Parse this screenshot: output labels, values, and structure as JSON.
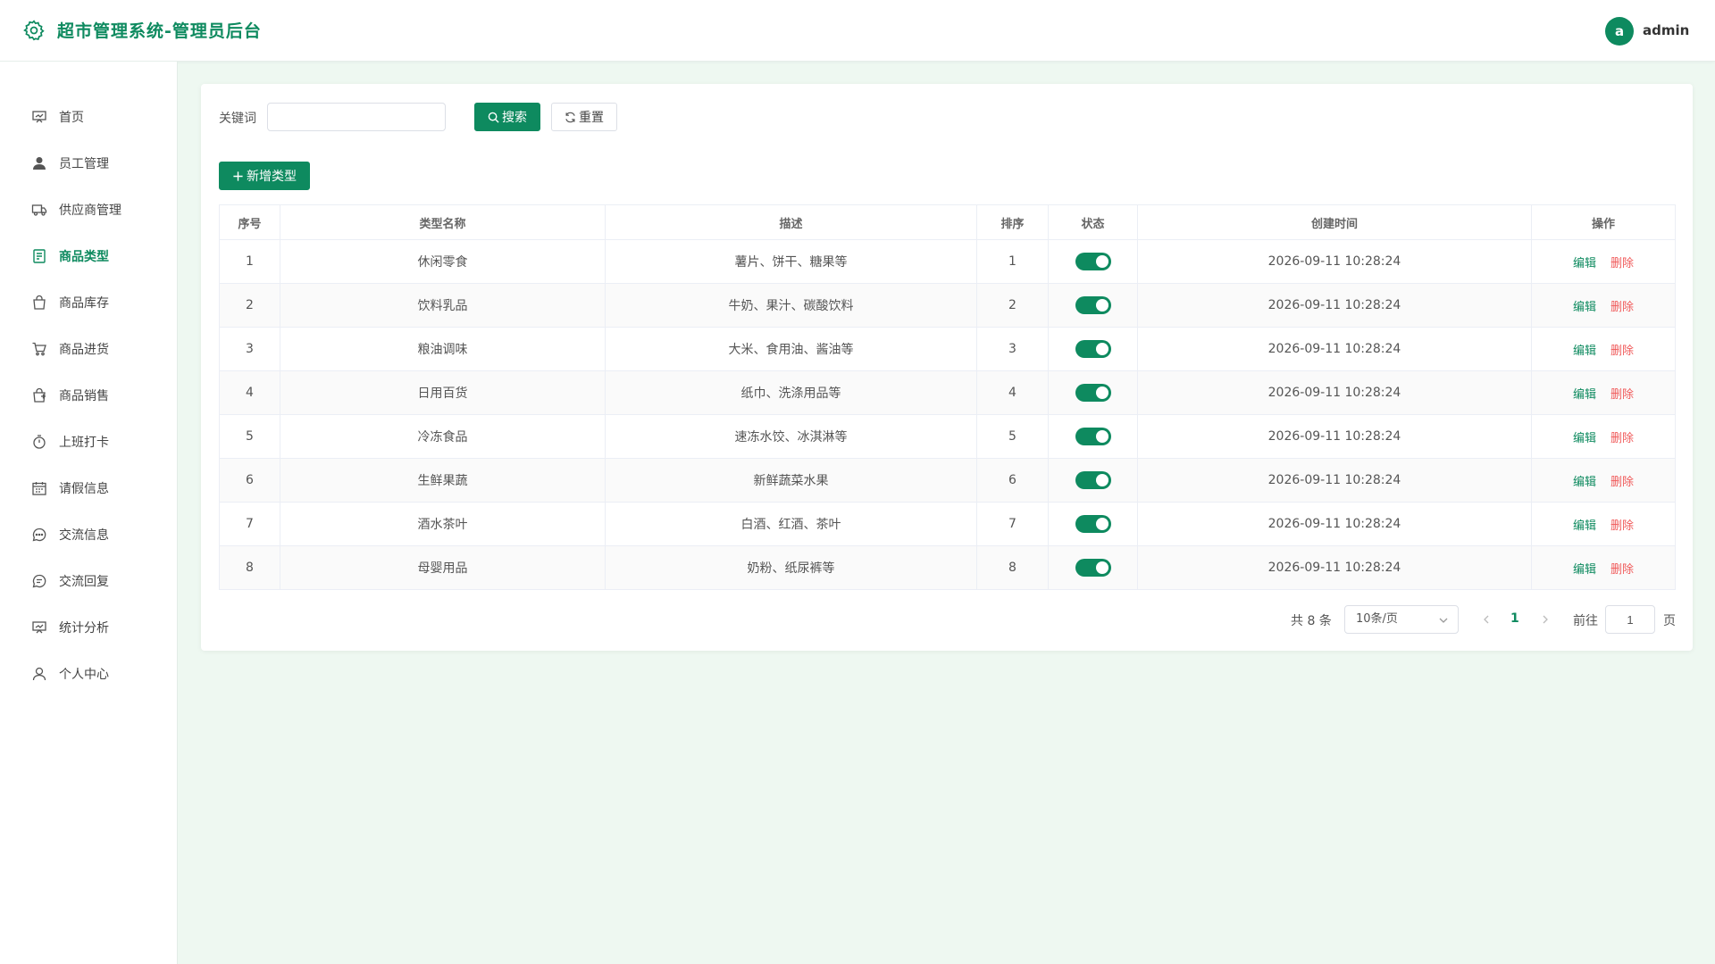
{
  "header": {
    "title": "超市管理系统-管理员后台",
    "avatar_letter": "a",
    "username": "admin"
  },
  "sidebar": {
    "items": [
      {
        "label": "首页",
        "icon": "dashboard-icon"
      },
      {
        "label": "员工管理",
        "icon": "user-icon"
      },
      {
        "label": "供应商管理",
        "icon": "truck-icon"
      },
      {
        "label": "商品类型",
        "icon": "notebook-icon",
        "active": true
      },
      {
        "label": "商品库存",
        "icon": "bag-icon"
      },
      {
        "label": "商品进货",
        "icon": "cart-icon"
      },
      {
        "label": "商品销售",
        "icon": "sale-icon"
      },
      {
        "label": "上班打卡",
        "icon": "stopwatch-icon"
      },
      {
        "label": "请假信息",
        "icon": "calendar-icon"
      },
      {
        "label": "交流信息",
        "icon": "chat-icon"
      },
      {
        "label": "交流回复",
        "icon": "chat-reply-icon"
      },
      {
        "label": "统计分析",
        "icon": "chart-icon"
      },
      {
        "label": "个人中心",
        "icon": "person-icon"
      }
    ]
  },
  "search": {
    "keyword_label": "关键词",
    "keyword_value": "",
    "keyword_placeholder": "",
    "search_label": "搜索",
    "reset_label": "重置"
  },
  "toolbar": {
    "add_label": "新增类型"
  },
  "table": {
    "headers": [
      "序号",
      "类型名称",
      "描述",
      "排序",
      "状态",
      "创建时间",
      "操作"
    ],
    "rows": [
      {
        "index": "1",
        "name": "休闲零食",
        "desc": "薯片、饼干、糖果等",
        "sort": "1",
        "status": true,
        "created": "2026-09-11 10:28:24"
      },
      {
        "index": "2",
        "name": "饮料乳品",
        "desc": "牛奶、果汁、碳酸饮料",
        "sort": "2",
        "status": true,
        "created": "2026-09-11 10:28:24"
      },
      {
        "index": "3",
        "name": "粮油调味",
        "desc": "大米、食用油、酱油等",
        "sort": "3",
        "status": true,
        "created": "2026-09-11 10:28:24"
      },
      {
        "index": "4",
        "name": "日用百货",
        "desc": "纸巾、洗涤用品等",
        "sort": "4",
        "status": true,
        "created": "2026-09-11 10:28:24"
      },
      {
        "index": "5",
        "name": "冷冻食品",
        "desc": "速冻水饺、冰淇淋等",
        "sort": "5",
        "status": true,
        "created": "2026-09-11 10:28:24"
      },
      {
        "index": "6",
        "name": "生鲜果蔬",
        "desc": "新鲜蔬菜水果",
        "sort": "6",
        "status": true,
        "created": "2026-09-11 10:28:24"
      },
      {
        "index": "7",
        "name": "酒水茶叶",
        "desc": "白酒、红酒、茶叶",
        "sort": "7",
        "status": true,
        "created": "2026-09-11 10:28:24"
      },
      {
        "index": "8",
        "name": "母婴用品",
        "desc": "奶粉、纸尿裤等",
        "sort": "8",
        "status": true,
        "created": "2026-09-11 10:28:24"
      }
    ],
    "edit_label": "编辑",
    "delete_label": "删除"
  },
  "pagination": {
    "total_label": "共 8 条",
    "page_size": "10条/页",
    "current_page": "1",
    "goto_label": "前往",
    "goto_value": "1",
    "page_suffix": "页"
  },
  "colors": {
    "accent": "#0e8a5f",
    "danger": "#f05a5a",
    "background": "#eef8f1"
  }
}
